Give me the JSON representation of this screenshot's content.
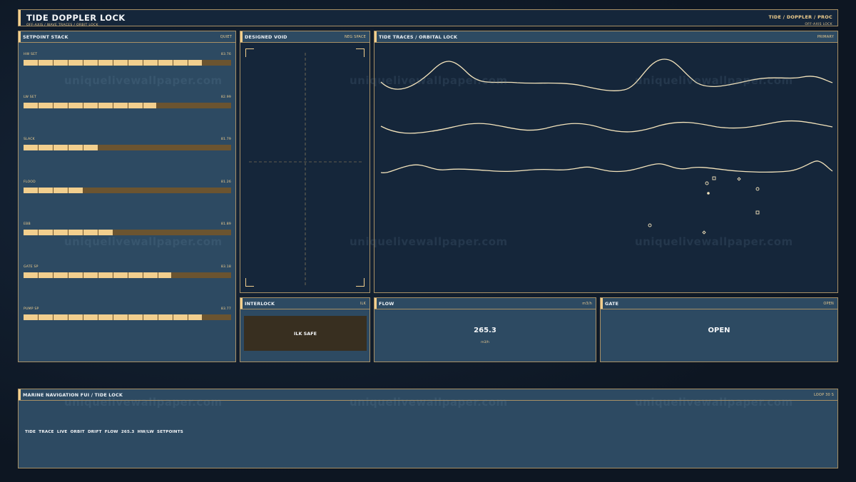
{
  "app": {
    "title": "TIDE DOPPLER LOCK",
    "subtitle": "OFF-AXIS  /  WAVE TRACES  /  ORBIT LOCK",
    "nav": "TIDE  /  DOPPLER  /  PROC",
    "mode": "OFF-AXIS  LOCK"
  },
  "setpoints": {
    "title": "SETPOINT STACK",
    "tag": "QUIET",
    "items": [
      {
        "label": "HW SET",
        "value": "83.76",
        "fill": 0.86
      },
      {
        "label": "LW SET",
        "value": "82.99",
        "fill": 0.64
      },
      {
        "label": "SLACK",
        "value": "81.79",
        "fill": 0.36
      },
      {
        "label": "FLOOD",
        "value": "81.26",
        "fill": 0.29
      },
      {
        "label": "EBB",
        "value": "81.89",
        "fill": 0.43
      },
      {
        "label": "GATE SP",
        "value": "83.18",
        "fill": 0.71
      },
      {
        "label": "PUMP SP",
        "value": "83.77",
        "fill": 0.86
      }
    ]
  },
  "void_panel": {
    "title": "DESIGNED VOID",
    "tag": "NEG SPACE"
  },
  "traces": {
    "title": "TIDE TRACES  /  ORBITAL LOCK",
    "tag": "PRIMARY"
  },
  "interlock": {
    "title": "INTERLOCK",
    "tag": "ILK",
    "status": "ILK SAFE"
  },
  "flow": {
    "title": "FLOW",
    "tag": "m3/h",
    "value": "265.3",
    "unit": "m3/h"
  },
  "gate": {
    "title": "GATE",
    "tag": "OPEN",
    "value": "OPEN"
  },
  "bottom": {
    "title": "MARINE NAVIGATION FUI  /  TIDE LOCK",
    "tag": "LOOP 30 S",
    "status": "TIDE TRACE LIVE   ORBIT DRIFT   FLOW 265.3   HW/LW SETPOINTS"
  },
  "watermark": "uniquelivewallpaper.com",
  "colors": {
    "accent": "#f2cf8e",
    "panel": "#2d4a62",
    "panel_dark": "#15263a",
    "border": "#a89065",
    "track": "#6b5430"
  }
}
